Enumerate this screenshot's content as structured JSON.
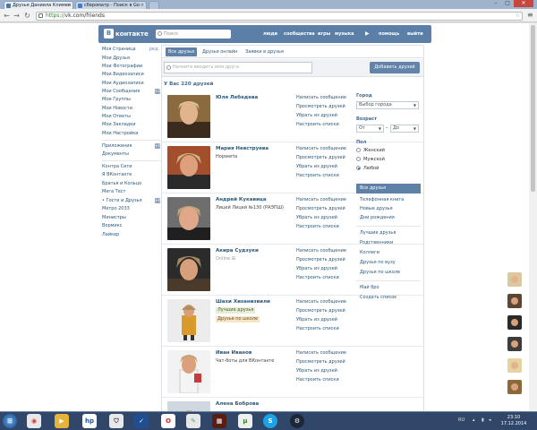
{
  "browser": {
    "tabs": [
      {
        "title": "Друзья Даниила Климен"
      },
      {
        "title": "сбероматр - Поиск в Go"
      }
    ],
    "win_controls": [
      "–",
      "▢",
      "✕"
    ],
    "address": {
      "scheme": "https://",
      "host": "vk.com/friends"
    }
  },
  "vk": {
    "logo_text": "контакте",
    "search_placeholder": "Поиск",
    "topmenu": [
      "люди",
      "сообщества",
      "игры",
      "музыка",
      "помощь",
      "выйти"
    ]
  },
  "leftmenu": {
    "items": [
      {
        "label": "Моя Страница",
        "right": "ред."
      },
      {
        "label": "Мои Друзья"
      },
      {
        "label": "Мои Фотографии"
      },
      {
        "label": "Мои Видеозаписи"
      },
      {
        "label": "Мои Аудиозаписи"
      },
      {
        "label": "Мои Сообщения",
        "count": "+3"
      },
      {
        "label": "Мои Группы"
      },
      {
        "label": "Мои Новости"
      },
      {
        "label": "Мои Ответы"
      },
      {
        "label": "Мои Закладки"
      },
      {
        "label": "Мои Настройки"
      }
    ],
    "items2": [
      {
        "label": "Приложения",
        "count": "+4"
      },
      {
        "label": "Документы"
      }
    ],
    "items3": [
      {
        "label": "Контра Сити"
      },
      {
        "label": "Я ВКонтакте"
      },
      {
        "label": "Братья и Кольцо"
      },
      {
        "label": "Мега Тест"
      },
      {
        "label": "• Гости и Друзья",
        "count": "+4"
      },
      {
        "label": "Метро 2033"
      },
      {
        "label": "Министры"
      },
      {
        "label": "Вормикс"
      },
      {
        "label": "Лайкер"
      }
    ]
  },
  "content": {
    "subtabs": [
      "Все друзья",
      "Друзья онлайн",
      "Заявки в друзья"
    ],
    "find_placeholder": "Начните вводить имя друга",
    "add_button": "Добавить друзей",
    "count_text": "У Вас 220 друзей",
    "actions": [
      "Написать сообщение",
      "Просмотреть друзей",
      "Убрать из друзей",
      "Настроить списки"
    ],
    "friends": [
      {
        "name": "Юля Лебедева",
        "sub": ""
      },
      {
        "name": "Мария Невструева",
        "sub": "Нoрwerta"
      },
      {
        "name": "Андрей Кукавица",
        "sub": "Лицей Лицей №130 (РАЭПШ)"
      },
      {
        "name": "Акира Судзуки",
        "sub": "Online ⊞"
      },
      {
        "name": "Шахи Хизанизвили",
        "sub": "",
        "tags": [
          "Лучшие друзья",
          "Друзья по школе"
        ]
      },
      {
        "name": "Иван Иванов",
        "sub": "Чат-боты для ВКонтакте"
      },
      {
        "name": "Алена Боброва",
        "sub": ""
      }
    ]
  },
  "filter": {
    "city_label": "Город",
    "city_value": "Выбор города",
    "age_label": "Возраст",
    "age_from": "От",
    "age_to": "До",
    "sex_label": "Пол",
    "sex_options": [
      "Женский",
      "Мужской",
      "Любой"
    ],
    "sex_selected": 2,
    "lists": [
      "Все друзья",
      "Телефонная книга",
      "Новые друзья",
      "Дни рождения"
    ],
    "lists2": [
      "Лучшие друзья",
      "Родственники",
      "Коллеги",
      "Друзья по вузу",
      "Друзья по школе"
    ],
    "lists3": [
      "Май бро",
      "Создать список"
    ]
  },
  "taskbar": {
    "lang": "RU",
    "time": "23:10",
    "date": "17.12.2014"
  },
  "colors": {
    "vk_blue": "#5b7fa6",
    "link": "#2b587a",
    "taskbar": "#30476a"
  }
}
